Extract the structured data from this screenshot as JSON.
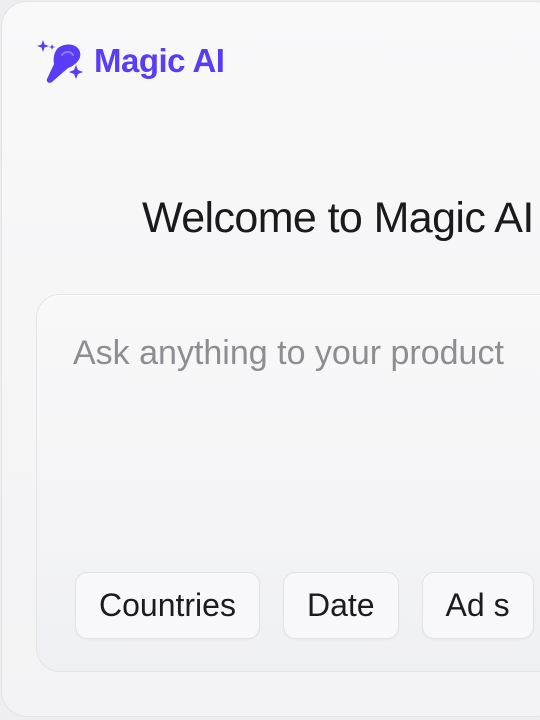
{
  "app": {
    "brand_name": "Magic AI",
    "brand_color": "#5b3cf5",
    "logo_icon": "sparkle-comet-icon"
  },
  "welcome": {
    "title": "Welcome to Magic AI"
  },
  "prompt": {
    "placeholder": "Ask anything to your product",
    "value": ""
  },
  "filters": [
    {
      "label": "Countries"
    },
    {
      "label": "Date"
    },
    {
      "label": "Ad s"
    }
  ]
}
